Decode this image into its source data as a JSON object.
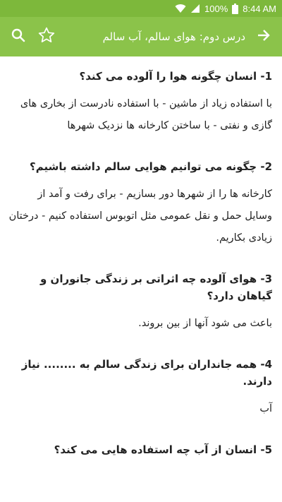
{
  "status_bar": {
    "wifi_icon": "wifi-icon",
    "signal_icon": "signal-icon",
    "battery_percent": "100%",
    "battery_icon": "battery-icon",
    "time": "8:44 AM"
  },
  "app_bar": {
    "title": "درس دوم: هوای سالم، آب سالم",
    "back_icon": "arrow-forward-icon",
    "star_icon": "star-outline-icon",
    "search_icon": "search-icon"
  },
  "colors": {
    "status_bar": "#7db83b",
    "app_bar": "#8bc34a"
  },
  "qa": [
    {
      "question": "1- انسان چگونه هوا را آلوده می کند؟",
      "answer": "با استفاده زیاد از ماشین - با استفاده نادرست از بخاری های گازی و نفتی - با ساختن کارخانه ها نزدیک شهرها"
    },
    {
      "question": "2- چگونه می توانیم هوایی سالم داشته باشیم؟",
      "answer": "کارخانه ها را از شهرها دور بسازیم - برای رفت و آمد از وسایل حمل و نقل عمومی مثل اتوبوس استفاده کنیم - درختان زیادی بکاریم."
    },
    {
      "question": "3- هوای آلوده چه اثراتی بر زندگی جانوران و گیاهان دارد؟",
      "answer": "باعث می شود آنها از بین بروند."
    },
    {
      "question": "4- همه جانداران برای زندگی سالم به ........ نیاز دارند.",
      "answer": "آب"
    },
    {
      "question": "5- انسان از آب چه استفاده هایی می کند؟",
      "answer": ""
    }
  ]
}
